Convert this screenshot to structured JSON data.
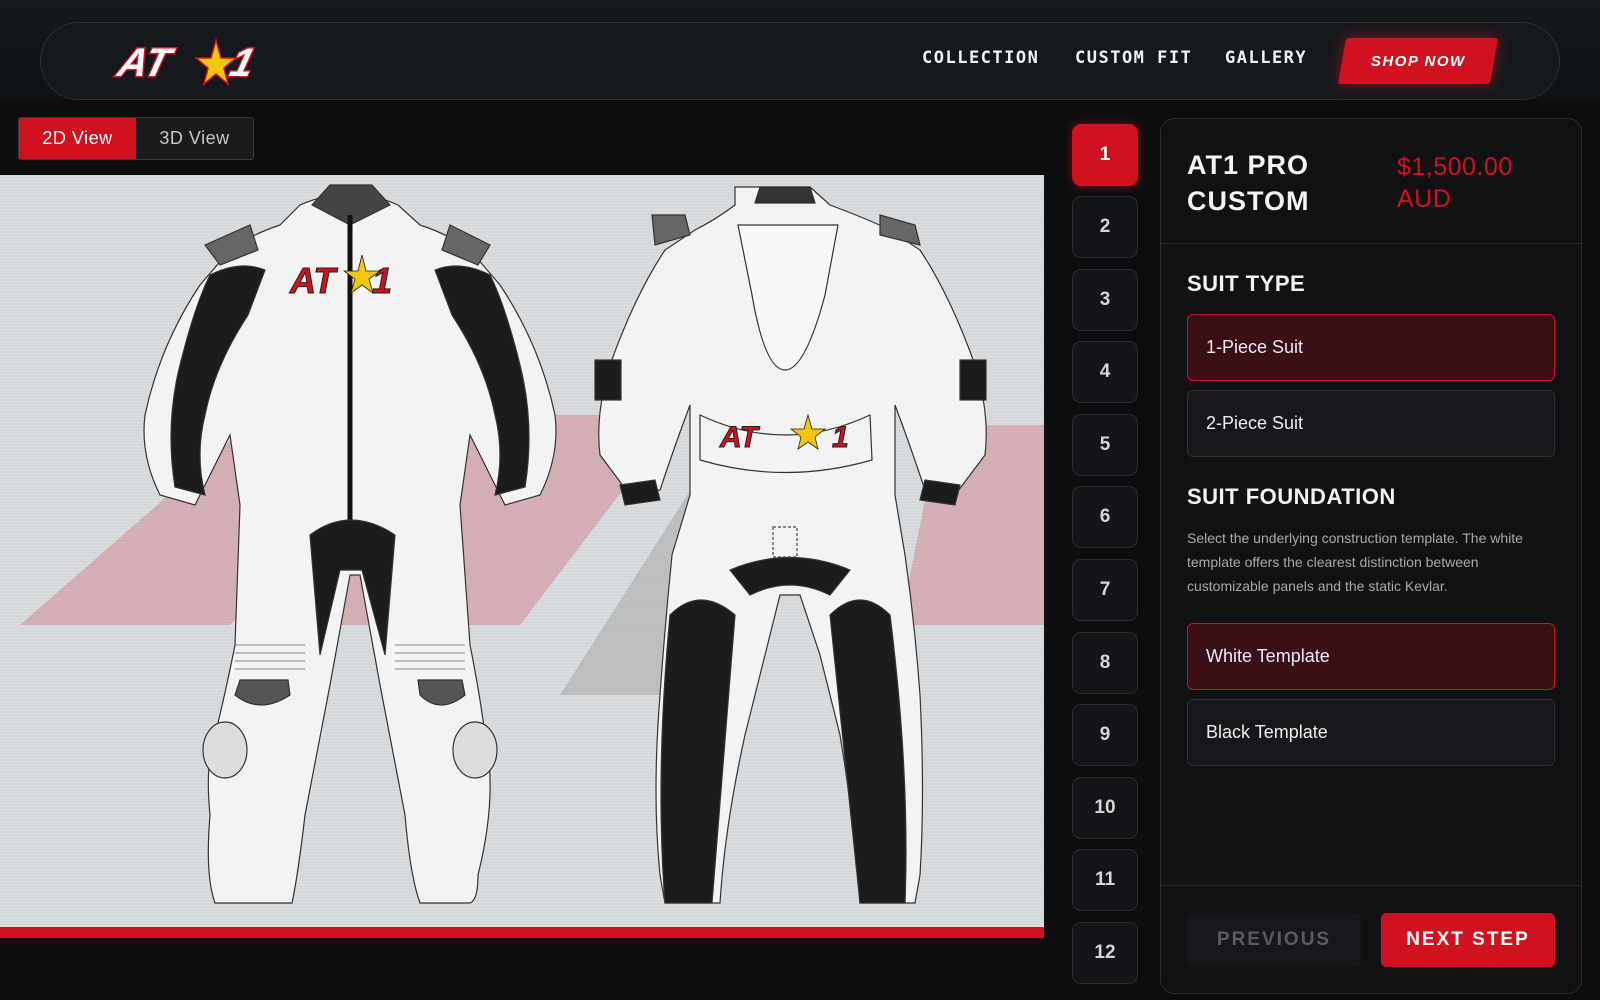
{
  "brand": {
    "logo_text": "AT",
    "logo_number": "1",
    "accent": "#d0111f"
  },
  "nav": {
    "links": [
      "COLLECTION",
      "CUSTOM FIT",
      "GALLERY"
    ],
    "cta": "SHOP NOW"
  },
  "view_toggle": {
    "options": [
      "2D View",
      "3D View"
    ],
    "selected": "2D View"
  },
  "steps": [
    "1",
    "2",
    "3",
    "4",
    "5",
    "6",
    "7",
    "8",
    "9",
    "10",
    "11",
    "12"
  ],
  "active_step": "1",
  "product": {
    "title_line1": "AT1 PRO",
    "title_line2": "CUSTOM",
    "price_line1": "$1,500.00",
    "price_line2": "AUD"
  },
  "suit_type": {
    "title": "SUIT TYPE",
    "options": [
      "1-Piece Suit",
      "2-Piece Suit"
    ],
    "selected": "1-Piece Suit"
  },
  "suit_foundation": {
    "title": "SUIT FOUNDATION",
    "description": "Select the underlying construction template. The white template offers the clearest distinction between customizable panels and the static Kevlar.",
    "options": [
      "White Template",
      "Black Template"
    ],
    "selected": "White Template"
  },
  "footer": {
    "previous": "PREVIOUS",
    "next": "NEXT STEP"
  }
}
